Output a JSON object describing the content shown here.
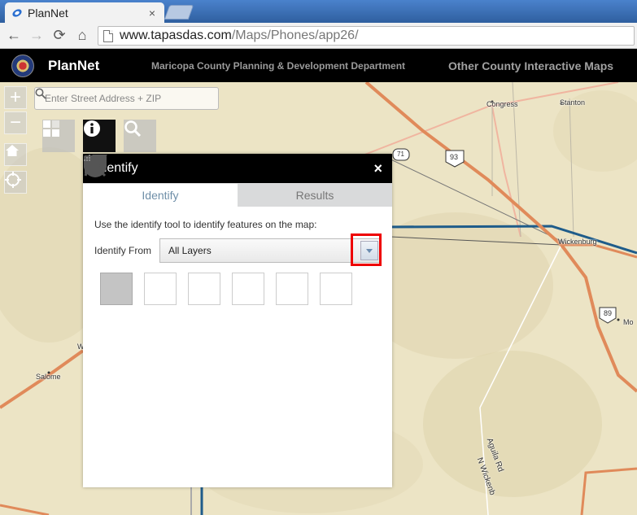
{
  "browser": {
    "tab_title": "PlanNet",
    "tab_close": "×",
    "url_host": "www.tapasdas.com",
    "url_path": "/Maps/Phones/app26/",
    "back": "←",
    "forward": "→",
    "reload": "⟳",
    "home": "⌂"
  },
  "app": {
    "title": "PlanNet",
    "department": "Maricopa County Planning & Development Department",
    "other_maps": "Other County Interactive Maps"
  },
  "map": {
    "zoom_in": "+",
    "zoom_out": "−",
    "search_placeholder": "Enter Street Address + ZIP",
    "labels": {
      "congress": "Congress",
      "stanton": "Stanton",
      "wickenburg": "Wickenburg",
      "salome": "Salome",
      "aguila_rd": "Aguila Rd",
      "n_wickenburg": "N Wickenb",
      "w": "W",
      "mo": "Mo",
      "hwy_71": "71",
      "hwy_93": "93",
      "hwy_89": "89"
    }
  },
  "identify_panel": {
    "title": "Identify",
    "close": "×",
    "tabs": [
      "Identify",
      "Results"
    ],
    "instruction": "Use the identify tool to identify features on the map:",
    "identify_from_label": "Identify From",
    "identify_from_value": "All Layers"
  },
  "colors": {
    "map_bg": "#ece4c5",
    "major_road": "#e08a5a",
    "minor_road": "#f0b5a0",
    "water_line": "#1f5c8a",
    "highlight": "#e00000"
  }
}
